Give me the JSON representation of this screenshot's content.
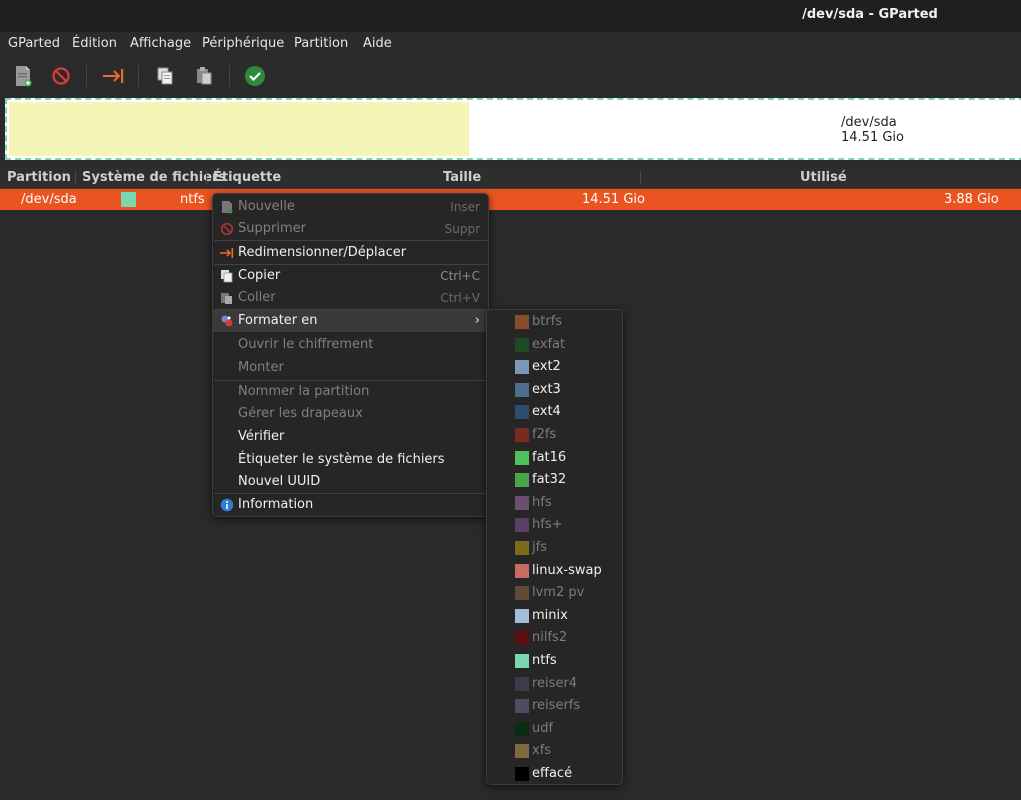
{
  "window": {
    "title": "/dev/sda - GParted"
  },
  "menubar": [
    "GParted",
    "Édition",
    "Affichage",
    "Périphérique",
    "Partition",
    "Aide"
  ],
  "toolbar": {
    "icons": [
      "new-partition-icon",
      "delete-icon",
      "resize-move-icon",
      "copy-icon",
      "paste-icon",
      "apply-icon"
    ]
  },
  "diskmap": {
    "device": "/dev/sda",
    "size": "14.51 Gio",
    "used_color": "#f6f5b8"
  },
  "columns": [
    "Partition",
    "Système de fichiers",
    "Étiquette",
    "Taille",
    "Utilisé"
  ],
  "row": {
    "partition": "/dev/sda",
    "filesystem": "ntfs",
    "fs_color": "#76d7b0",
    "size": "14.51 Gio",
    "used": "3.88 Gio"
  },
  "context_menu": {
    "items": [
      {
        "label": "Nouvelle",
        "shortcut": "Inser",
        "enabled": false,
        "icon": "new-partition-icon"
      },
      {
        "label": "Supprimer",
        "shortcut": "Suppr",
        "enabled": false,
        "icon": "delete-icon"
      },
      {
        "label": "Redimensionner/Déplacer",
        "shortcut": "",
        "enabled": true,
        "icon": "resize-move-icon"
      },
      {
        "label": "Copier",
        "shortcut": "Ctrl+C",
        "enabled": true,
        "icon": "copy-icon"
      },
      {
        "label": "Coller",
        "shortcut": "Ctrl+V",
        "enabled": false,
        "icon": "paste-icon"
      },
      {
        "label": "Formater en",
        "shortcut": "",
        "enabled": true,
        "icon": "format-icon",
        "submenu": true
      },
      {
        "label": "Ouvrir le chiffrement",
        "shortcut": "",
        "enabled": false
      },
      {
        "label": "Monter",
        "shortcut": "",
        "enabled": false
      },
      {
        "label": "Nommer la partition",
        "shortcut": "",
        "enabled": false
      },
      {
        "label": "Gérer les drapeaux",
        "shortcut": "",
        "enabled": false
      },
      {
        "label": "Vérifier",
        "shortcut": "",
        "enabled": true
      },
      {
        "label": "Étiqueter le système de fichiers",
        "shortcut": "",
        "enabled": true
      },
      {
        "label": "Nouvel UUID",
        "shortcut": "",
        "enabled": true
      },
      {
        "label": "Information",
        "shortcut": "",
        "enabled": true,
        "icon": "info-icon"
      }
    ]
  },
  "format_submenu": {
    "items": [
      {
        "label": "btrfs",
        "color": "#874c2c",
        "enabled": false
      },
      {
        "label": "exfat",
        "color": "#1d4a22",
        "enabled": false
      },
      {
        "label": "ext2",
        "color": "#7a97b6",
        "enabled": true
      },
      {
        "label": "ext3",
        "color": "#4d6f8e",
        "enabled": true
      },
      {
        "label": "ext4",
        "color": "#2e4d6e",
        "enabled": true
      },
      {
        "label": "f2fs",
        "color": "#7a2a1f",
        "enabled": false
      },
      {
        "label": "fat16",
        "color": "#4fbf58",
        "enabled": true
      },
      {
        "label": "fat32",
        "color": "#48a64a",
        "enabled": true
      },
      {
        "label": "hfs",
        "color": "#6b4f70",
        "enabled": false
      },
      {
        "label": "hfs+",
        "color": "#5c3e63",
        "enabled": false
      },
      {
        "label": "jfs",
        "color": "#7d6a1c",
        "enabled": false
      },
      {
        "label": "linux-swap",
        "color": "#c96a63",
        "enabled": true
      },
      {
        "label": "lvm2 pv",
        "color": "#5e4a35",
        "enabled": false
      },
      {
        "label": "minix",
        "color": "#a4bcda",
        "enabled": true
      },
      {
        "label": "nilfs2",
        "color": "#5a0e0e",
        "enabled": false
      },
      {
        "label": "ntfs",
        "color": "#76d7b0",
        "enabled": true
      },
      {
        "label": "reiser4",
        "color": "#3f3b4d",
        "enabled": false
      },
      {
        "label": "reiserfs",
        "color": "#4f4b60",
        "enabled": false
      },
      {
        "label": "udf",
        "color": "#0d2d12",
        "enabled": false
      },
      {
        "label": "xfs",
        "color": "#7e6a3f",
        "enabled": false
      },
      {
        "label": "effacé",
        "color": "#000000",
        "enabled": true
      }
    ]
  }
}
